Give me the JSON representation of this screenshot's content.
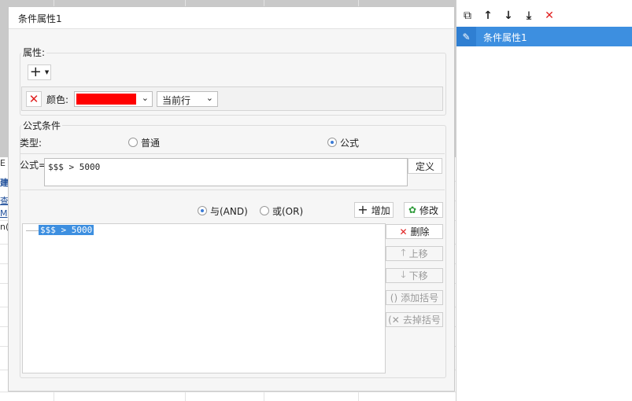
{
  "background": {
    "fragments": [
      "E",
      "建",
      "查",
      "M",
      "n("
    ]
  },
  "dialog": {
    "title": "条件属性1",
    "property_group": {
      "legend": "属性:",
      "add_symbol": "+",
      "delete_symbol": "✕",
      "color_label": "颜色:",
      "color_value": "#ff0000",
      "scope_value": "当前行"
    },
    "formula_group": {
      "legend": "公式条件",
      "type_label": "类型:",
      "type_options": [
        "普通",
        "公式"
      ],
      "type_selected": "公式",
      "formula_label": "公式=",
      "formula_value": "$$$ > 5000",
      "define_button": "定义",
      "logic_options": [
        "与(AND)",
        "或(OR)"
      ],
      "logic_selected": "与(AND)",
      "add_button": "增加",
      "modify_button": "修改",
      "delete_button": "删除",
      "move_up_button": "上移",
      "move_down_button": "下移",
      "add_bracket_button": "添加括号",
      "remove_bracket_button": "去掉括号",
      "condition_list": [
        "$$$ > 5000"
      ]
    }
  },
  "right_panel": {
    "toolbar_icons": [
      "copy-icon",
      "arrow-up-icon",
      "arrow-down-icon",
      "move-bottom-icon",
      "delete-icon"
    ],
    "items": [
      {
        "label": "条件属性1",
        "selected": true
      }
    ],
    "colors": {
      "selected_bg": "#3d8fe0",
      "delete_red": "#e02020"
    }
  }
}
